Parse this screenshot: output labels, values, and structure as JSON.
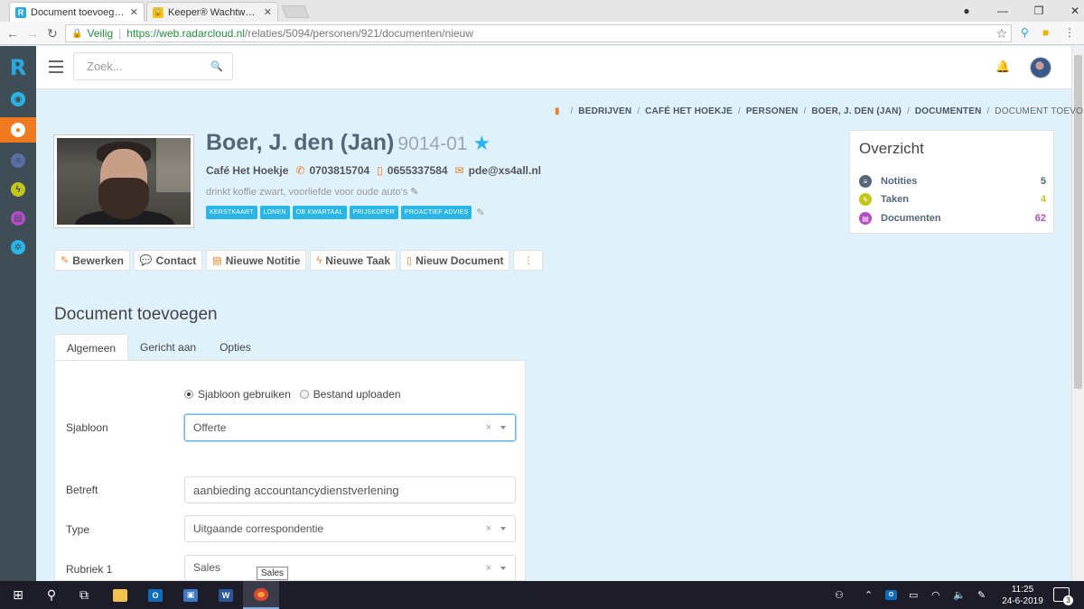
{
  "browser": {
    "tabs": [
      {
        "title": "Document toevoegen - R",
        "active": true
      },
      {
        "title": "Keeper® Wachtwoordbe",
        "active": false
      }
    ],
    "security_label": "Veilig",
    "url_base": "https://web.radarcloud.nl",
    "url_path": "/relaties/5094/personen/921/documenten/nieuw"
  },
  "app": {
    "logo": "R",
    "search_placeholder": "Zoek..."
  },
  "breadcrumb": {
    "items": [
      "BEDRIJVEN",
      "CAFÉ HET HOEKJE",
      "PERSONEN",
      "BOER, J. DEN (JAN)",
      "DOCUMENTEN"
    ],
    "current": "DOCUMENT TOEVOEGEN"
  },
  "person": {
    "name": "Boer, J. den (Jan)",
    "code": "9014-01",
    "company": "Café Het Hoekje",
    "phone": "0703815704",
    "mobile": "0655337584",
    "email": "pde@xs4all.nl",
    "note": "drinkt koffie zwart, voorliefde voor oude auto's",
    "tags": [
      "KERSTKAART",
      "LONEN",
      "OB KWARTAAL",
      "PRIJSKOPER",
      "PROACTIEF ADVIES"
    ]
  },
  "actions": {
    "edit": "Bewerken",
    "contact": "Contact",
    "new_note": "Nieuwe Notitie",
    "new_task": "Nieuwe Taak",
    "new_document": "Nieuw Document"
  },
  "overview": {
    "title": "Overzicht",
    "rows": [
      {
        "label": "Notities",
        "count": "5",
        "color": "#55667a"
      },
      {
        "label": "Taken",
        "count": "4",
        "color": "#c3c718"
      },
      {
        "label": "Documenten",
        "count": "62",
        "color": "#b44cc4"
      }
    ]
  },
  "form": {
    "title": "Document toevoegen",
    "tabs": [
      "Algemeen",
      "Gericht aan",
      "Opties"
    ],
    "radio_template": "Sjabloon gebruiken",
    "radio_upload": "Bestand uploaden",
    "fields": {
      "sjabloon_label": "Sjabloon",
      "sjabloon_value": "Offerte",
      "betreft_label": "Betreft",
      "betreft_value": "aanbieding accountancydienstverlening",
      "type_label": "Type",
      "type_value": "Uitgaande correspondentie",
      "rubriek_label": "Rubriek 1",
      "rubriek_value": "Sales"
    },
    "tooltip": "Sales"
  },
  "taskbar": {
    "time": "11:25",
    "date": "24-6-2019",
    "notifications": "3"
  },
  "colors": {
    "accent": "#f07a1f",
    "brand": "#29a9e0",
    "rail": "#3f4d57",
    "content_bg": "#dff1fb"
  }
}
